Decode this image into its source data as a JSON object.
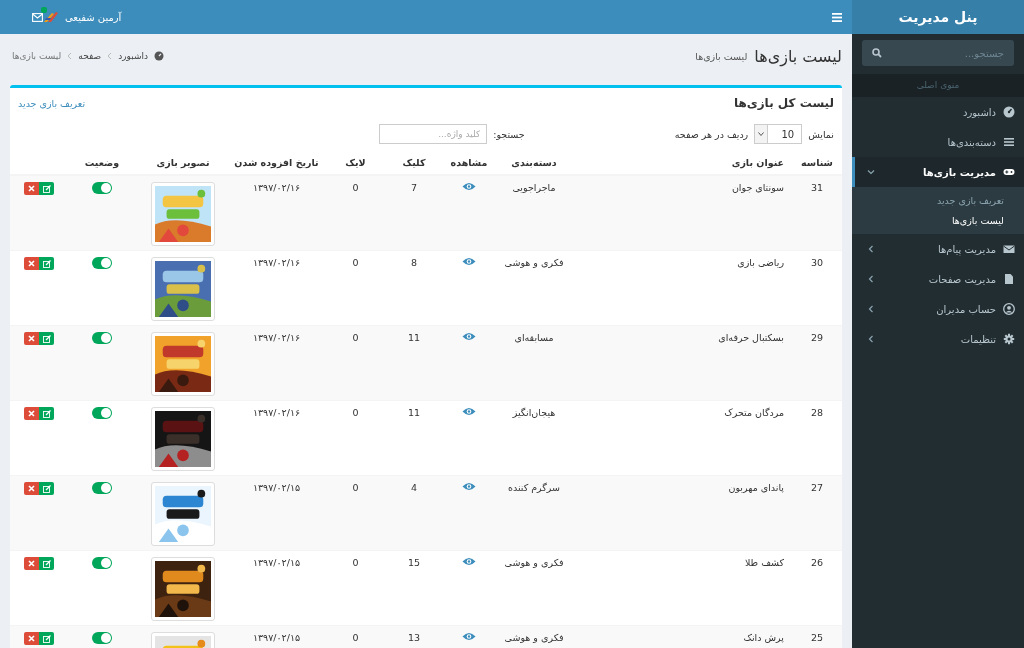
{
  "sidebar": {
    "title": "پنل مدیریت",
    "search": {
      "placeholder": "جستجو..."
    },
    "menu_header": "منوی اصلی",
    "items": [
      {
        "label": "داشبورد",
        "expandable": false,
        "selected": false
      },
      {
        "label": "دسته‌بندی‌ها",
        "expandable": false,
        "selected": false
      },
      {
        "label": "مدیریت بازی‌ها",
        "expandable": true,
        "expanded": true,
        "selected": true,
        "children": [
          {
            "label": "تعریف بازی جدید",
            "selected": false
          },
          {
            "label": "لیست بازی‌ها",
            "selected": true
          }
        ]
      },
      {
        "label": "مدیریت پیام‌ها",
        "expandable": true,
        "expanded": false,
        "selected": false
      },
      {
        "label": "مدیریت صفحات",
        "expandable": true,
        "expanded": false,
        "selected": false
      },
      {
        "label": "حساب مدیران",
        "expandable": true,
        "expanded": false,
        "selected": false
      },
      {
        "label": "تنظیمات",
        "expandable": true,
        "expanded": false,
        "selected": false
      }
    ]
  },
  "topbar": {
    "user_name": "آرمین شفیعی",
    "messages_badge": true
  },
  "page_header": {
    "title": "لیست بازی‌ها",
    "subtitle": "لیست بازی‌ها",
    "breadcrumb": [
      "داشبورد",
      "صفحه",
      "لیست بازی‌ها"
    ]
  },
  "box": {
    "title": "لیست کل بازی‌ها",
    "add_link": "تعریف بازی جدید",
    "length": {
      "label_before": "نمایش",
      "value": "10",
      "label_after": "ردیف در هر صفحه"
    },
    "search": {
      "label": "جستجو:",
      "placeholder": "کلید واژه..."
    },
    "columns": [
      "شناسه",
      "عنوان بازی",
      "دسته‌بندی",
      "مشاهده",
      "کلیک",
      "لایک",
      "تاریخ افزوده شدن",
      "تصویر بازی",
      "وضعیت"
    ],
    "rows": [
      {
        "id": "31",
        "title": "سونتای جوان",
        "category": "ماجراجویی",
        "clicks": "7",
        "likes": "0",
        "date": "۱۳۹۷/۰۲/۱۶",
        "active": true
      },
      {
        "id": "30",
        "title": "ریاضی بازی",
        "category": "فکری و هوشی",
        "clicks": "8",
        "likes": "0",
        "date": "۱۳۹۷/۰۲/۱۶",
        "active": true
      },
      {
        "id": "29",
        "title": "بسکتبال حرفه‌ای",
        "category": "مسابقه‌ای",
        "clicks": "11",
        "likes": "0",
        "date": "۱۳۹۷/۰۲/۱۶",
        "active": true
      },
      {
        "id": "28",
        "title": "مردگان متحرک",
        "category": "هیجان‌انگیز",
        "clicks": "11",
        "likes": "0",
        "date": "۱۳۹۷/۰۲/۱۶",
        "active": true
      },
      {
        "id": "27",
        "title": "پاندای مهربون",
        "category": "سرگرم کننده",
        "clicks": "4",
        "likes": "0",
        "date": "۱۳۹۷/۰۲/۱۵",
        "active": true
      },
      {
        "id": "26",
        "title": "کشف طلا",
        "category": "فکری و هوشی",
        "clicks": "15",
        "likes": "0",
        "date": "۱۳۹۷/۰۲/۱۵",
        "active": true
      },
      {
        "id": "25",
        "title": "پرش دانک",
        "category": "فکری و هوشی",
        "clicks": "13",
        "likes": "0",
        "date": "۱۳۹۷/۰۲/۱۵",
        "active": true
      }
    ]
  }
}
